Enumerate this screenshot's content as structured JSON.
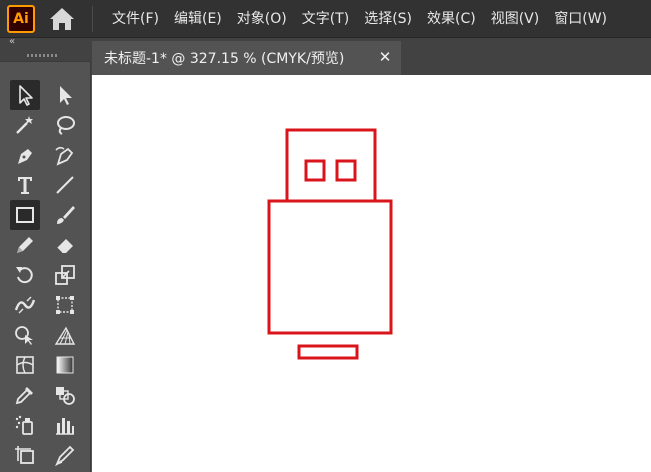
{
  "app": {
    "logo_text": "Ai",
    "logo_color": "#ff9a00"
  },
  "menu": {
    "items": [
      "文件(F)",
      "编辑(E)",
      "对象(O)",
      "文字(T)",
      "选择(S)",
      "效果(C)",
      "视图(V)",
      "窗口(W)"
    ]
  },
  "tools": {
    "collapse_glyph": "«",
    "rows": [
      [
        "selection-tool",
        "direct-selection-tool"
      ],
      [
        "magic-wand-tool",
        "lasso-tool"
      ],
      [
        "pen-tool",
        "curvature-tool"
      ],
      [
        "type-tool",
        "line-segment-tool"
      ],
      [
        "rectangle-tool",
        "paintbrush-tool"
      ],
      [
        "pencil-tool",
        "eraser-tool"
      ],
      [
        "rotate-tool",
        "scale-tool"
      ],
      [
        "width-tool",
        "free-transform-tool"
      ],
      [
        "shape-builder-tool",
        "perspective-grid-tool"
      ],
      [
        "mesh-tool",
        "gradient-tool"
      ],
      [
        "eyedropper-tool",
        "blend-tool"
      ],
      [
        "symbol-sprayer-tool",
        "column-graph-tool"
      ],
      [
        "artboard-tool",
        "slice-tool"
      ]
    ],
    "selected": [
      "selection-tool",
      "rectangle-tool"
    ]
  },
  "document": {
    "tab_title": "未标题-1* @ 327.15 % (CMYK/预览)",
    "close_glyph": "✕"
  },
  "artwork": {
    "stroke_color": "#d9151b",
    "description_shapes": [
      "usb-head",
      "usb-contact-left",
      "usb-contact-right",
      "usb-body",
      "usb-cap"
    ]
  }
}
